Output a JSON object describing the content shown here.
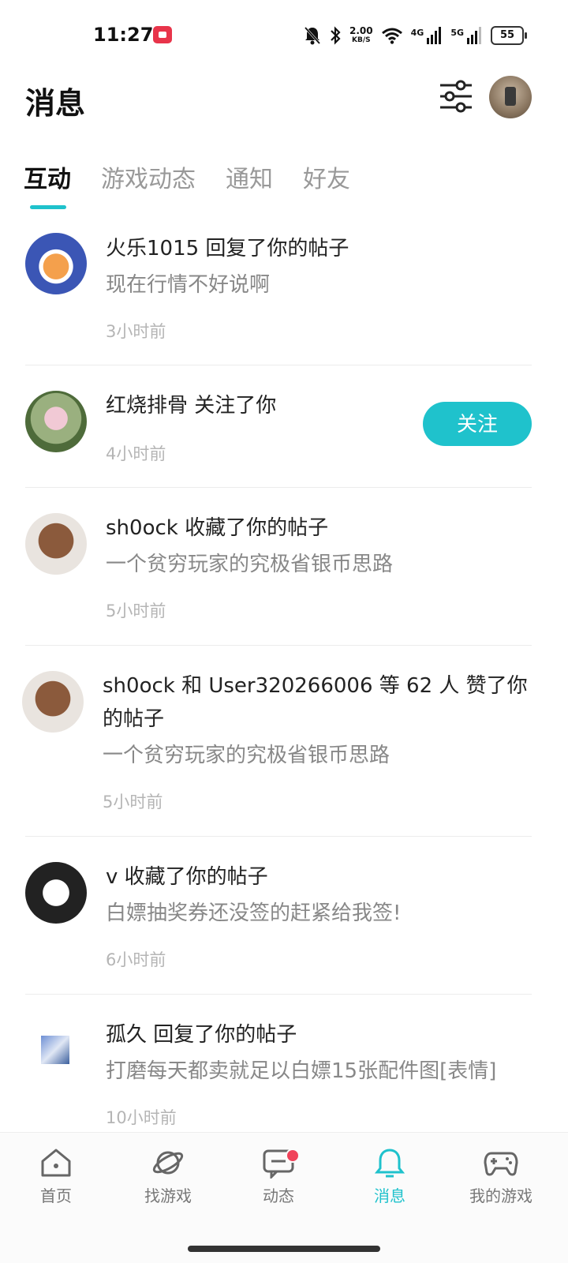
{
  "status_bar": {
    "time": "11:27",
    "net_speed_value": "2.00",
    "net_speed_unit": "KB/S",
    "sig1_label": "4G",
    "sig2_label": "5G",
    "battery": "55"
  },
  "header": {
    "title": "消息"
  },
  "tabs": [
    {
      "label": "互动",
      "active": true
    },
    {
      "label": "游戏动态",
      "active": false
    },
    {
      "label": "通知",
      "active": false
    },
    {
      "label": "好友",
      "active": false
    }
  ],
  "messages": [
    {
      "title": "火乐1015 回复了你的帖子",
      "preview": "现在行情不好说啊",
      "time": "3小时前"
    },
    {
      "title": "红烧排骨 关注了你",
      "preview": "",
      "time": "4小时前",
      "button": "关注"
    },
    {
      "title": "sh0ock 收藏了你的帖子",
      "preview": "一个贫穷玩家的究极省银币思路",
      "time": "5小时前"
    },
    {
      "title_line1": "sh0ock 和 User320266006 等 62 人 赞了你",
      "title_line2": "的帖子",
      "preview": "一个贫穷玩家的究极省银币思路",
      "time": "5小时前"
    },
    {
      "title": "v 收藏了你的帖子",
      "preview": "白嫖抽奖券还没签的赶紧给我签!",
      "time": "6小时前"
    },
    {
      "title": "孤久 回复了你的帖子",
      "preview": "打磨每天都卖就足以白嫖15张配件图[表情]",
      "time": "10小时前"
    }
  ],
  "bottom_nav": [
    {
      "label": "首页",
      "icon": "home-icon"
    },
    {
      "label": "找游戏",
      "icon": "planet-icon"
    },
    {
      "label": "动态",
      "icon": "chat-icon"
    },
    {
      "label": "消息",
      "icon": "bell-icon",
      "active": true
    },
    {
      "label": "我的游戏",
      "icon": "gamepad-icon"
    }
  ],
  "colors": {
    "accent": "#1fc2cc",
    "badge": "#f0435a"
  }
}
